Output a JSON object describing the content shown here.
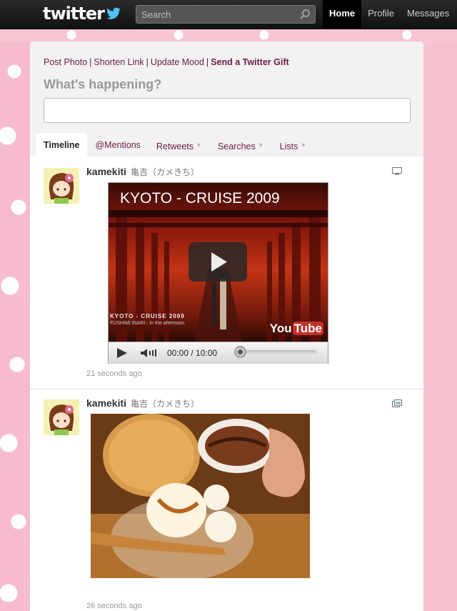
{
  "nav": {
    "logo": "twitter",
    "search_placeholder": "Search",
    "links": [
      "Home",
      "Profile",
      "Messages"
    ]
  },
  "compose": {
    "actions": [
      "Post Photo",
      "Shorten Link",
      "Update Mood"
    ],
    "gift": "Send a Twitter Gift",
    "prompt": "What's happening?"
  },
  "tabs": [
    "Timeline",
    "@Mentions",
    "Retweets",
    "Searches",
    "Lists"
  ],
  "tweets": [
    {
      "username": "kamekiti",
      "fullname": "亀吉（カメきち）",
      "timestamp": "21 seconds ago",
      "video": {
        "title": "KYOTO - CRUISE 2009",
        "subtitle": "KYOTO - CRUISE 2009",
        "caption": "FUSHIMI INARI - in the afternoon",
        "time": "00:00 / 10:00",
        "logo_a": "You",
        "logo_b": "Tube"
      }
    },
    {
      "username": "kamekiti",
      "fullname": "亀吉（カメきち）",
      "timestamp": "26 seconds ago"
    }
  ]
}
